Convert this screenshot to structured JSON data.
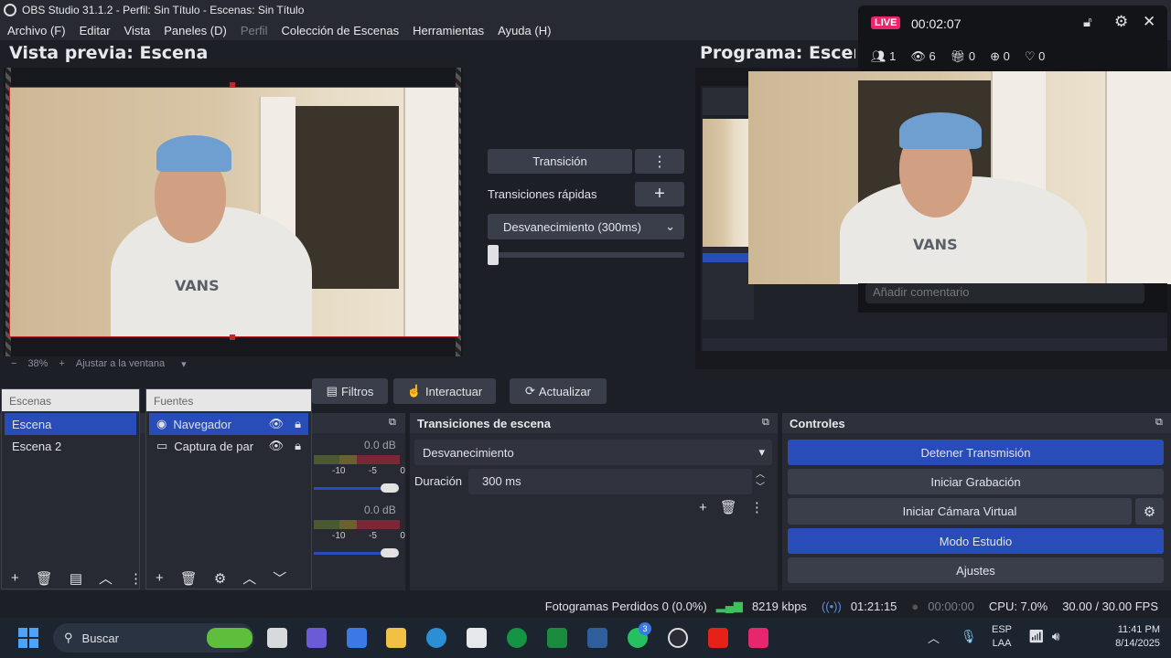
{
  "window": {
    "title": "OBS Studio 31.1.2 - Perfil: Sin Título - Escenas: Sin Título"
  },
  "menu": [
    {
      "label": "Archivo (F)",
      "disabled": false
    },
    {
      "label": "Editar",
      "disabled": false
    },
    {
      "label": "Vista",
      "disabled": false
    },
    {
      "label": "Paneles (D)",
      "disabled": false
    },
    {
      "label": "Perfil",
      "disabled": true
    },
    {
      "label": "Colección de Escenas",
      "disabled": false
    },
    {
      "label": "Herramientas",
      "disabled": false
    },
    {
      "label": "Ayuda (H)",
      "disabled": false
    }
  ],
  "preview": {
    "title": "Vista previa: Escena",
    "zoom": "38%",
    "fit_label": "Ajustar a la ventana"
  },
  "program": {
    "title": "Programa: Escena"
  },
  "transition_center": {
    "transition_button": "Transición",
    "quick_label": "Transiciones rápidas",
    "selected": "Desvanecimiento (300ms)"
  },
  "toolbar": {
    "filters": "Filtros",
    "interact": "Interactuar",
    "refresh": "Actualizar"
  },
  "scenes": {
    "title": "Escenas",
    "items": [
      "Escena",
      "Escena 2"
    ]
  },
  "sources": {
    "title": "Fuentes",
    "items": [
      "Navegador",
      "Captura de par"
    ]
  },
  "mixer": {
    "levels": [
      "0.0 dB",
      "0.0 dB"
    ],
    "ticks": [
      "-10",
      "-5",
      "0"
    ]
  },
  "scene_transitions": {
    "title": "Transiciones de escena",
    "type": "Desvanecimiento",
    "duration_label": "Duración",
    "duration": "300 ms"
  },
  "controls": {
    "title": "Controles",
    "stop_stream": "Detener Transmisión",
    "start_record": "Iniciar Grabación",
    "start_vcam": "Iniciar Cámara Virtual",
    "studio_mode": "Modo Estudio",
    "settings": "Ajustes"
  },
  "status": {
    "dropped": "Fotogramas Perdidos 0 (0.0%)",
    "bitrate": "8219 kbps",
    "stream_time": "01:21:15",
    "rec_time": "00:00:00",
    "cpu": "CPU: 7.0%",
    "fps": "30.00 / 30.00 FPS"
  },
  "live_overlay": {
    "badge": "LIVE",
    "time": "00:02:07",
    "stats": [
      "1",
      "6",
      "0",
      "0",
      "0"
    ],
    "comment_placeholder": "Añadir comentario"
  },
  "taskbar": {
    "search": "Buscar",
    "lang": "ESP",
    "layout": "LAA",
    "time": "11:41 PM",
    "date": "8/14/2025",
    "whatsapp_badge": "3"
  },
  "colors": {
    "accent": "#284cb8",
    "live": "#e8266d",
    "bg": "#1d1f26",
    "panel": "#272a33"
  }
}
